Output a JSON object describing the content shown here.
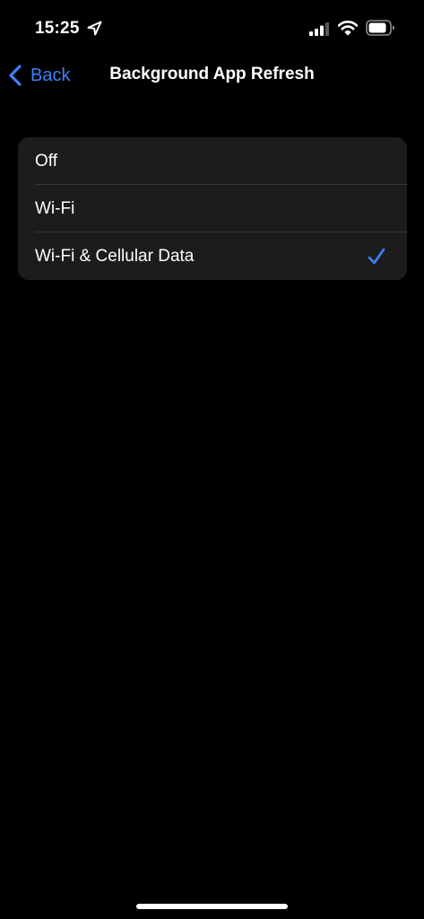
{
  "status_bar": {
    "time": "15:25",
    "icons": [
      "location-arrow-icon",
      "cellular-signal-icon",
      "wifi-icon",
      "battery-icon"
    ]
  },
  "nav": {
    "back_label": "Back",
    "title": "Background App Refresh"
  },
  "options": [
    {
      "label": "Off",
      "selected": false
    },
    {
      "label": "Wi-Fi",
      "selected": false
    },
    {
      "label": "Wi-Fi & Cellular Data",
      "selected": true
    }
  ],
  "colors": {
    "background": "#000000",
    "group_background": "#1c1c1e",
    "accent": "#3b82f6",
    "separator": "#38383a",
    "text": "#ffffff"
  }
}
